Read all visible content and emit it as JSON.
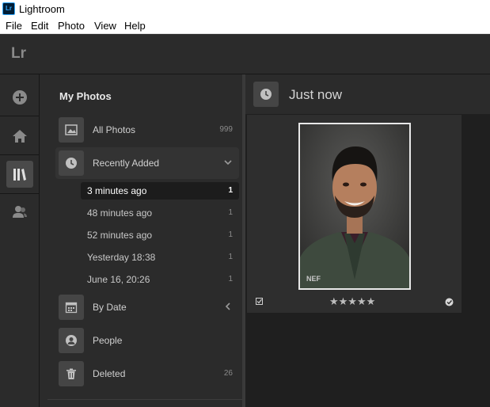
{
  "window": {
    "title": "Lightroom",
    "icon_text": "Lr"
  },
  "menu": [
    "File",
    "Edit",
    "Photo",
    "View",
    "Help"
  ],
  "topbar": {
    "logo": "Lr"
  },
  "rail": [
    {
      "name": "add-photos",
      "icon": "plus-circle-icon"
    },
    {
      "name": "home",
      "icon": "home-icon"
    },
    {
      "name": "library",
      "icon": "library-icon",
      "active": true
    },
    {
      "name": "people",
      "icon": "people-icon"
    }
  ],
  "panel": {
    "title": "My Photos",
    "all_photos": {
      "label": "All Photos",
      "count": "999",
      "icon": "image-icon"
    },
    "recently_added": {
      "label": "Recently Added",
      "icon": "clock-icon",
      "items": [
        {
          "label": "3 minutes ago",
          "count": "1",
          "selected": true
        },
        {
          "label": "48 minutes ago",
          "count": "1"
        },
        {
          "label": "52 minutes ago",
          "count": "1"
        },
        {
          "label": "Yesterday 18:38",
          "count": "1"
        },
        {
          "label": "June 16, 20:26",
          "count": "1"
        }
      ]
    },
    "by_date": {
      "label": "By Date",
      "icon": "calendar-icon"
    },
    "people": {
      "label": "People",
      "icon": "person-icon"
    },
    "deleted": {
      "label": "Deleted",
      "count": "26",
      "icon": "trash-icon"
    }
  },
  "content": {
    "header_title": "Just now",
    "photo": {
      "format": "NEF",
      "stars": "★★★★★",
      "rating": 5
    }
  },
  "colors": {
    "panel_bg": "#2b2b2b",
    "content_bg": "#1f1f1f",
    "accent_lr": "#31a8ff"
  }
}
